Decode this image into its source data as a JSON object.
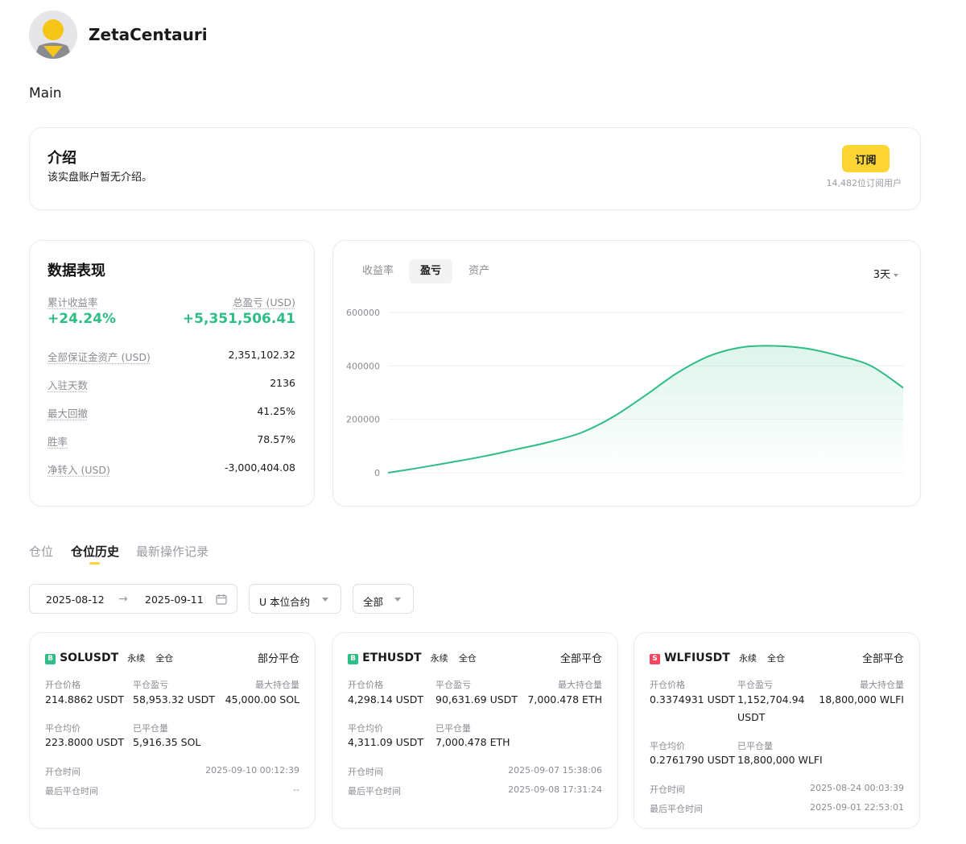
{
  "profile": {
    "username": "ZetaCentauri",
    "section": "Main"
  },
  "intro": {
    "title": "介绍",
    "text": "该实盘账户暂无介绍。",
    "subscribe_label": "订阅",
    "subscribers": "14,482位订阅用户"
  },
  "stats": {
    "title": "数据表现",
    "cumulative_return_label": "累计收益率",
    "cumulative_return": "+24.24%",
    "total_pnl_label": "总盈亏 (USD)",
    "total_pnl": "+5,351,506.41",
    "rows": [
      {
        "label": "全部保证金资产 (USD)",
        "value": "2,351,102.32"
      },
      {
        "label": "入驻天数",
        "value": "2136"
      },
      {
        "label": "最大回撤",
        "value": "41.25%"
      },
      {
        "label": "胜率",
        "value": "78.57%"
      },
      {
        "label": "净转入 (USD)",
        "value": "-3,000,404.08"
      }
    ]
  },
  "chart_tabs": [
    "收益率",
    "盈亏",
    "资产"
  ],
  "chart_active_tab": "盈亏",
  "chart_range": "3天",
  "chart_data": {
    "type": "area",
    "title": "",
    "xlabel": "",
    "ylabel": "",
    "ylim": [
      0,
      600000
    ],
    "yticks": [
      0,
      200000,
      400000,
      600000
    ],
    "ytick_labels": [
      "0",
      "200000",
      "400000",
      "600000"
    ],
    "grid": true,
    "color": "#2ebd85",
    "x": [
      0,
      1,
      2,
      3,
      4,
      5,
      6,
      7,
      8,
      9,
      10,
      11,
      12,
      13,
      14,
      15,
      16
    ],
    "values": [
      0,
      19000,
      40000,
      62000,
      88000,
      115000,
      150000,
      210000,
      290000,
      375000,
      438000,
      470000,
      475000,
      465000,
      438000,
      400000,
      318000
    ]
  },
  "positions_tabs": [
    "仓位",
    "仓位历史",
    "最新操作记录"
  ],
  "positions_active_tab": "仓位历史",
  "filters": {
    "date_from": "2025-08-12",
    "date_to": "2025-09-11",
    "contract_type": "U 本位合约",
    "scope": "全部"
  },
  "positions": [
    {
      "badge": "B",
      "badge_color": "#2ebd85",
      "symbol": "SOLUSDT",
      "type": "永续",
      "margin": "全仓",
      "status": "部分平仓",
      "open_price_label": "开仓价格",
      "open_price": "214.8862 USDT",
      "pnl_label": "平仓盈亏",
      "pnl": "58,953.32 USDT",
      "max_label": "最大持仓量",
      "max": "45,000.00 SOL",
      "avg_label": "平仓均价",
      "avg": "223.8000 USDT",
      "closed_label": "已平仓量",
      "closed": "5,916.35 SOL",
      "open_time_label": "开仓时间",
      "open_time": "2025-09-10 00:12:39",
      "last_close_label": "最后平仓时间",
      "last_close": "--"
    },
    {
      "badge": "B",
      "badge_color": "#2ebd85",
      "symbol": "ETHUSDT",
      "type": "永续",
      "margin": "全仓",
      "status": "全部平仓",
      "open_price_label": "开仓价格",
      "open_price": "4,298.14 USDT",
      "pnl_label": "平仓盈亏",
      "pnl": "90,631.69 USDT",
      "max_label": "最大持仓量",
      "max": "7,000.478 ETH",
      "avg_label": "平仓均价",
      "avg": "4,311.09 USDT",
      "closed_label": "已平仓量",
      "closed": "7,000.478 ETH",
      "open_time_label": "开仓时间",
      "open_time": "2025-09-07 15:38:06",
      "last_close_label": "最后平仓时间",
      "last_close": "2025-09-08 17:31:24"
    },
    {
      "badge": "S",
      "badge_color": "#f6465d",
      "symbol": "WLFIUSDT",
      "type": "永续",
      "margin": "全仓",
      "status": "全部平仓",
      "open_price_label": "开仓价格",
      "open_price": "0.3374931 USDT",
      "pnl_label": "平仓盈亏",
      "pnl_line1": "1,152,704.94",
      "pnl_line2": "USDT",
      "max_label": "最大持仓量",
      "max": "18,800,000 WLFI",
      "avg_label": "平仓均价",
      "avg": "0.2761790 USDT",
      "closed_label": "已平仓量",
      "closed": "18,800,000 WLFI",
      "open_time_label": "开仓时间",
      "open_time": "2025-08-24 00:03:39",
      "last_close_label": "最后平仓时间",
      "last_close": "2025-09-01 22:53:01"
    }
  ]
}
